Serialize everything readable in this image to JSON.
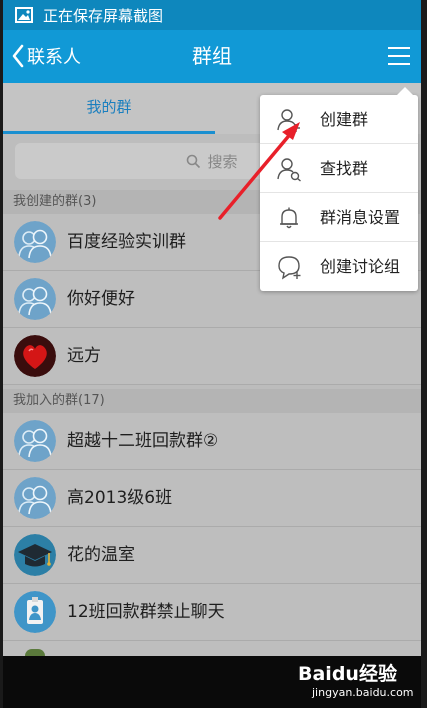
{
  "status_bar": {
    "text": "正在保存屏幕截图",
    "icon": "image-icon"
  },
  "header": {
    "back_label": "联系人",
    "title": "群组",
    "menu_icon": "hamburger-menu-icon"
  },
  "tabs": [
    {
      "label": "我的群",
      "active": true
    },
    {
      "label": ""
    }
  ],
  "search": {
    "placeholder": "搜索"
  },
  "sections": [
    {
      "title": "我创建的群(3)",
      "groups": [
        {
          "name": "百度经验实训群",
          "avatar": "default-group-avatar"
        },
        {
          "name": "你好便好",
          "avatar": "default-group-avatar"
        },
        {
          "name": "远方",
          "avatar": "red-heart-avatar"
        }
      ]
    },
    {
      "title": "我加入的群(17)",
      "groups": [
        {
          "name": "超越十二班回款群②",
          "avatar": "default-group-avatar"
        },
        {
          "name": "高2013级6班",
          "avatar": "default-group-avatar"
        },
        {
          "name": "花的温室",
          "avatar": "graduation-cap-avatar"
        },
        {
          "name": "12班回款群禁止聊天",
          "avatar": "id-badge-avatar"
        }
      ]
    }
  ],
  "dropdown_menu": [
    {
      "label": "创建群",
      "icon": "add-user-icon"
    },
    {
      "label": "查找群",
      "icon": "find-user-icon"
    },
    {
      "label": "群消息设置",
      "icon": "bell-icon"
    },
    {
      "label": "创建讨论组",
      "icon": "chat-bubble-add-icon"
    }
  ],
  "colors": {
    "header_bg": "#1199d6",
    "status_bg": "#0e87bd",
    "tab_active": "#1a7fbf",
    "annotation_arrow": "#e8202a"
  },
  "watermark": {
    "brand": "Baidu经验",
    "url": "jingyan.baidu.com"
  }
}
